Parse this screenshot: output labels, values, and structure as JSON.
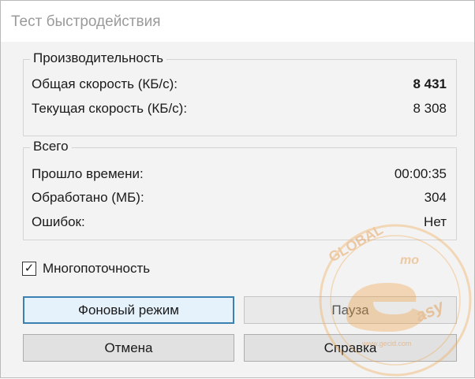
{
  "window": {
    "title": "Тест быстродействия"
  },
  "performance": {
    "legend": "Производительность",
    "overall_label": "Общая скорость (КБ/с):",
    "overall_value": "8 431",
    "current_label": "Текущая скорость (КБ/с):",
    "current_value": "8 308"
  },
  "totals": {
    "legend": "Всего",
    "elapsed_label": "Прошло времени:",
    "elapsed_value": "00:00:35",
    "processed_label": "Обработано (МБ):",
    "processed_value": "304",
    "errors_label": "Ошибок:",
    "errors_value": "Нет"
  },
  "multithread": {
    "label": "Многопоточность",
    "checked": true,
    "mark": "✓"
  },
  "buttons": {
    "background": "Фоновый режим",
    "pause": "Пауза",
    "cancel": "Отмена",
    "help": "Справка"
  },
  "watermark": {
    "global": "GLOBAL",
    "easy": "asy",
    "mo": "mo",
    "url": "www.gecid.com"
  },
  "colors": {
    "accent": "#3c7fb1",
    "watermark": "#f2a64a"
  }
}
